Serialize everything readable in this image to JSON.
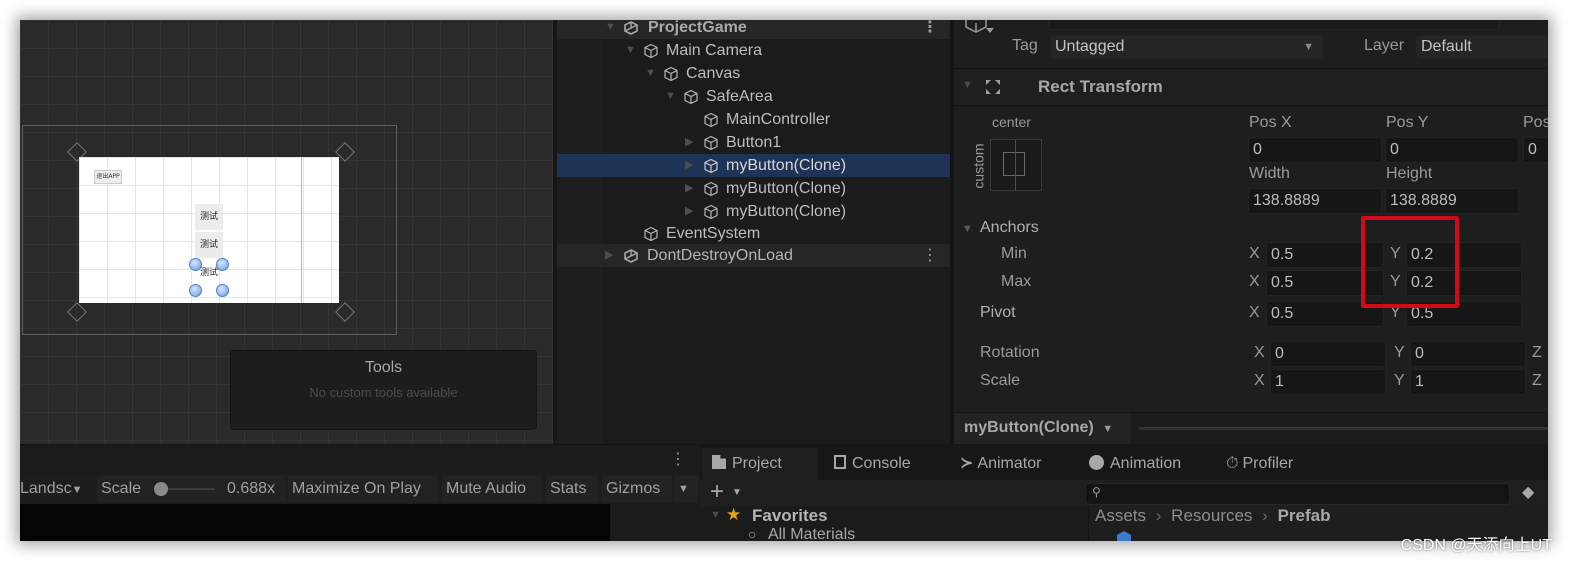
{
  "scene": {
    "game_preview": {
      "exit_button_label": "退出APP",
      "buttons": [
        "测试",
        "测试",
        "测试"
      ]
    },
    "tools_overlay": {
      "title": "Tools",
      "message": "No custom tools available"
    }
  },
  "hierarchy": {
    "items": [
      {
        "label": "ProjectGame",
        "type": "scene",
        "expanded": true
      },
      {
        "label": "Main Camera",
        "type": "gameobject",
        "expanded": true
      },
      {
        "label": "Canvas",
        "type": "gameobject",
        "expanded": true
      },
      {
        "label": "SafeArea",
        "type": "gameobject",
        "expanded": true
      },
      {
        "label": "MainController",
        "type": "gameobject"
      },
      {
        "label": "Button1",
        "type": "gameobject",
        "expanded": false
      },
      {
        "label": "myButton(Clone)",
        "type": "gameobject",
        "expanded": false,
        "selected": true
      },
      {
        "label": "myButton(Clone)",
        "type": "gameobject",
        "expanded": false
      },
      {
        "label": "myButton(Clone)",
        "type": "gameobject",
        "expanded": false
      },
      {
        "label": "EventSystem",
        "type": "gameobject"
      },
      {
        "label": "DontDestroyOnLoad",
        "type": "scene",
        "expanded": false
      }
    ]
  },
  "inspector": {
    "tag_label": "Tag",
    "tag_value": "Untagged",
    "layer_label": "Layer",
    "layer_value": "Default",
    "component_title": "Rect Transform",
    "anchor_preset_top": "center",
    "anchor_preset_side": "custom",
    "pos_x_label": "Pos X",
    "pos_x": "0",
    "pos_y_label": "Pos Y",
    "pos_y": "0",
    "pos_z_label": "Pos Z",
    "pos_z": "0",
    "width_label": "Width",
    "width": "138.8889",
    "height_label": "Height",
    "height": "138.8889",
    "anchors_label": "Anchors",
    "min_label": "Min",
    "min_x": "0.5",
    "min_y": "0.2",
    "max_label": "Max",
    "max_x": "0.5",
    "max_y": "0.2",
    "pivot_label": "Pivot",
    "pivot_x": "0.5",
    "pivot_y": "0.5",
    "rotation_label": "Rotation",
    "rotation_x": "0",
    "rotation_y": "0",
    "scale_label": "Scale",
    "scale_x": "1",
    "scale_y": "1",
    "axis_x": "X",
    "axis_y": "Y",
    "axis_z": "Z",
    "selected_object": "myButton(Clone)",
    "highlight_color": "#d00b17"
  },
  "game_toolbar": {
    "aspect": "Landsc",
    "scale_label": "Scale",
    "scale_value": "0.688x",
    "scale_slider_fraction": 0.0,
    "maximize_on_play": "Maximize On Play",
    "mute_audio": "Mute Audio",
    "stats": "Stats",
    "gizmos": "Gizmos"
  },
  "project_panel": {
    "tabs": [
      {
        "label": "Project",
        "icon": "folder-icon",
        "active": true
      },
      {
        "label": "Console",
        "icon": "console-icon"
      },
      {
        "label": "Animator",
        "icon": "animator-icon"
      },
      {
        "label": "Animation",
        "icon": "animation-icon"
      },
      {
        "label": "Profiler",
        "icon": "profiler-icon"
      }
    ],
    "search_placeholder": "",
    "favorites_label": "Favorites",
    "favorites_items": [
      "All Materials"
    ],
    "breadcrumb": [
      "Assets",
      "Resources",
      "Prefab"
    ],
    "accent_star_color": "#e2a21a"
  },
  "watermark": "CSDN @天添向上UT"
}
